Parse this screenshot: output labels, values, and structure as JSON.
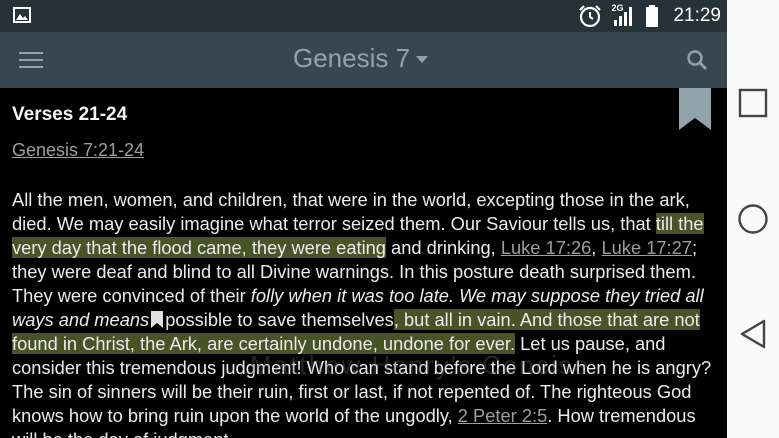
{
  "status_bar": {
    "time": "21:29",
    "network_label": "2G",
    "icons": [
      "gallery-icon",
      "alarm-icon",
      "signal-icon",
      "battery-icon"
    ]
  },
  "toolbar": {
    "title": "Genesis 7",
    "icons": [
      "menu-icon",
      "dropdown-caret-icon",
      "search-icon"
    ]
  },
  "commentary": {
    "heading": "Verses 21-24",
    "reference_link": "Genesis 7:21-24",
    "bookmark_icon": "bookmark-icon",
    "paragraph": [
      {
        "t": "All the men, women, and children, that were in the world, excepting those in the ark, died. We may easily imagine what terror seized them. Our Saviour tells us, that "
      },
      {
        "t": "till the very day that the flood came, they were eating",
        "style": "highlight"
      },
      {
        "t": " and drinking, "
      },
      {
        "t": "Luke 17:26",
        "style": "link"
      },
      {
        "t": ", "
      },
      {
        "t": "Luke 17:27",
        "style": "link"
      },
      {
        "t": "; they were deaf and blind to all Divine warnings. In this posture death surprised them. They were convinced of their "
      },
      {
        "t": "folly when it was too late. We may suppose they tried all ways and means",
        "style": "italic"
      },
      {
        "t": " ",
        "style": "handle"
      },
      {
        "t": "possible to save themselves"
      },
      {
        "t": ", but all in vain. And those that are not found in Christ, the Ark, are certainly undone, undone for ever.",
        "style": "highlight"
      },
      {
        "t": " Let us pause, and consider this tremendous judgment! Who can stand before the Lord when he is angry? The sin of sinners will be their ruin, first or last, if not repented of. The righteous God knows how to bring ruin upon the world of the ungodly, "
      },
      {
        "t": "2 Peter 2:5",
        "style": "link"
      },
      {
        "t": ". How tremendous will be the day of judgment"
      }
    ],
    "watermark": "Matthew Henry's Concise"
  },
  "colors": {
    "status_bar": "#263238",
    "toolbar": "#37474f",
    "toolbar_text": "#90a4ae",
    "highlight": "#4a5328",
    "link": "#9e9e9e",
    "body_text": "#ececec",
    "background": "#000000",
    "navbar": "#fafafa"
  },
  "navigation_bar": {
    "icons": [
      "recent-apps-icon",
      "home-icon",
      "back-icon"
    ]
  }
}
